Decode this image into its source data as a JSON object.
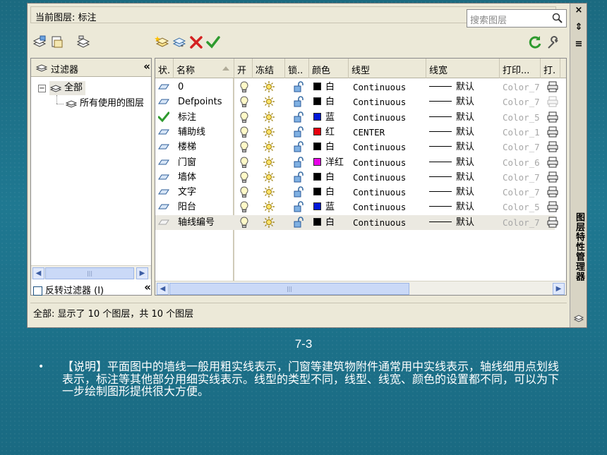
{
  "window": {
    "current_layer": "当前图层: 标注",
    "search_placeholder": "搜索图层",
    "vertical_title": "图层特性管理器",
    "status_text": "全部: 显示了 10 个图层，共 10 个图层"
  },
  "title_controls": [
    "×",
    "⇕",
    "≡"
  ],
  "filter_pane": {
    "header": "过滤器",
    "collapse": "«",
    "tree": [
      {
        "label": "全部",
        "expand": "−"
      },
      {
        "label": "所有使用的图层"
      }
    ],
    "invert_label": "反转过滤器 (I)"
  },
  "columns": [
    "状.",
    "名称",
    "开",
    "冻结",
    "锁..",
    "颜色",
    "线型",
    "线宽",
    "打印...",
    "打."
  ],
  "layers": [
    {
      "status": "layer",
      "name": "0",
      "color_name": "白",
      "color_hex": "#000000",
      "linetype": "Continuous",
      "lineweight": "默认",
      "plot_style": "Color_7",
      "plot_enabled": true
    },
    {
      "status": "layer",
      "name": "Defpoints",
      "color_name": "白",
      "color_hex": "#000000",
      "linetype": "Continuous",
      "lineweight": "默认",
      "plot_style": "Color_7",
      "plot_enabled": false
    },
    {
      "status": "current",
      "name": "标注",
      "color_name": "蓝",
      "color_hex": "#0018d8",
      "linetype": "Continuous",
      "lineweight": "默认",
      "plot_style": "Color_5",
      "plot_enabled": true
    },
    {
      "status": "layer",
      "name": "辅助线",
      "color_name": "红",
      "color_hex": "#e8000f",
      "linetype": "CENTER",
      "lineweight": "默认",
      "plot_style": "Color_1",
      "plot_enabled": true
    },
    {
      "status": "layer",
      "name": "楼梯",
      "color_name": "白",
      "color_hex": "#000000",
      "linetype": "Continuous",
      "lineweight": "默认",
      "plot_style": "Color_7",
      "plot_enabled": true
    },
    {
      "status": "layer",
      "name": "门窗",
      "color_name": "洋红",
      "color_hex": "#e800e8",
      "linetype": "Continuous",
      "lineweight": "默认",
      "plot_style": "Color_6",
      "plot_enabled": true
    },
    {
      "status": "layer",
      "name": "墙体",
      "color_name": "白",
      "color_hex": "#000000",
      "linetype": "Continuous",
      "lineweight": "默认",
      "plot_style": "Color_7",
      "plot_enabled": true
    },
    {
      "status": "layer",
      "name": "文字",
      "color_name": "白",
      "color_hex": "#000000",
      "linetype": "Continuous",
      "lineweight": "默认",
      "plot_style": "Color_7",
      "plot_enabled": true
    },
    {
      "status": "layer",
      "name": "阳台",
      "color_name": "蓝",
      "color_hex": "#0018d8",
      "linetype": "Continuous",
      "lineweight": "默认",
      "plot_style": "Color_5",
      "plot_enabled": true
    },
    {
      "status": "layer-off",
      "name": "轴线编号",
      "color_name": "白",
      "color_hex": "#000000",
      "linetype": "Continuous",
      "lineweight": "默认",
      "plot_style": "Color_7",
      "plot_enabled": true
    }
  ],
  "slide": {
    "caption": "7-3",
    "bullet": "•",
    "note": "【说明】平面图中的墙线一般用粗实线表示，门窗等建筑物附件通常用中实线表示，轴线细用点划线表示，标注等其他部分用细实线表示。线型的类型不同，线型、线宽、颜色的设置都不同，可以为下一步绘制图形提供很大方便。"
  }
}
